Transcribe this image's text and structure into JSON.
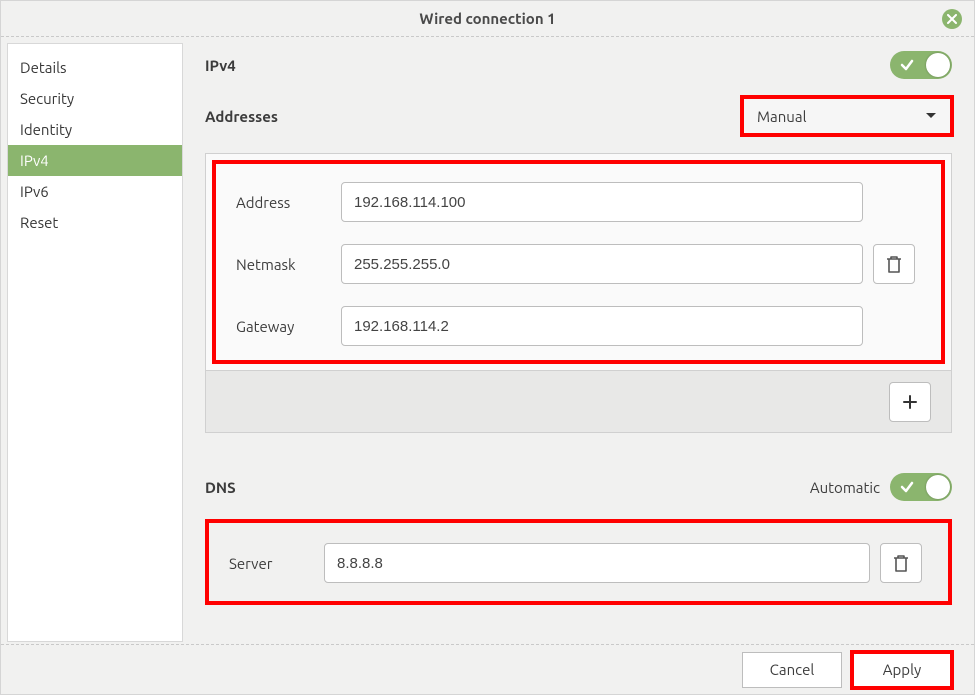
{
  "window": {
    "title": "Wired connection 1"
  },
  "sidebar": {
    "items": [
      {
        "label": "Details",
        "key": "details"
      },
      {
        "label": "Security",
        "key": "security"
      },
      {
        "label": "Identity",
        "key": "identity"
      },
      {
        "label": "IPv4",
        "key": "ipv4",
        "selected": true
      },
      {
        "label": "IPv6",
        "key": "ipv6"
      },
      {
        "label": "Reset",
        "key": "reset"
      }
    ]
  },
  "ipv4": {
    "title": "IPv4",
    "enabled": true,
    "addresses_label": "Addresses",
    "method": "Manual",
    "fields": {
      "address_label": "Address",
      "netmask_label": "Netmask",
      "gateway_label": "Gateway",
      "address": "192.168.114.100",
      "netmask": "255.255.255.0",
      "gateway": "192.168.114.2"
    }
  },
  "dns": {
    "title": "DNS",
    "automatic_label": "Automatic",
    "automatic": true,
    "server_label": "Server",
    "server": "8.8.8.8"
  },
  "footer": {
    "cancel": "Cancel",
    "apply": "Apply"
  }
}
